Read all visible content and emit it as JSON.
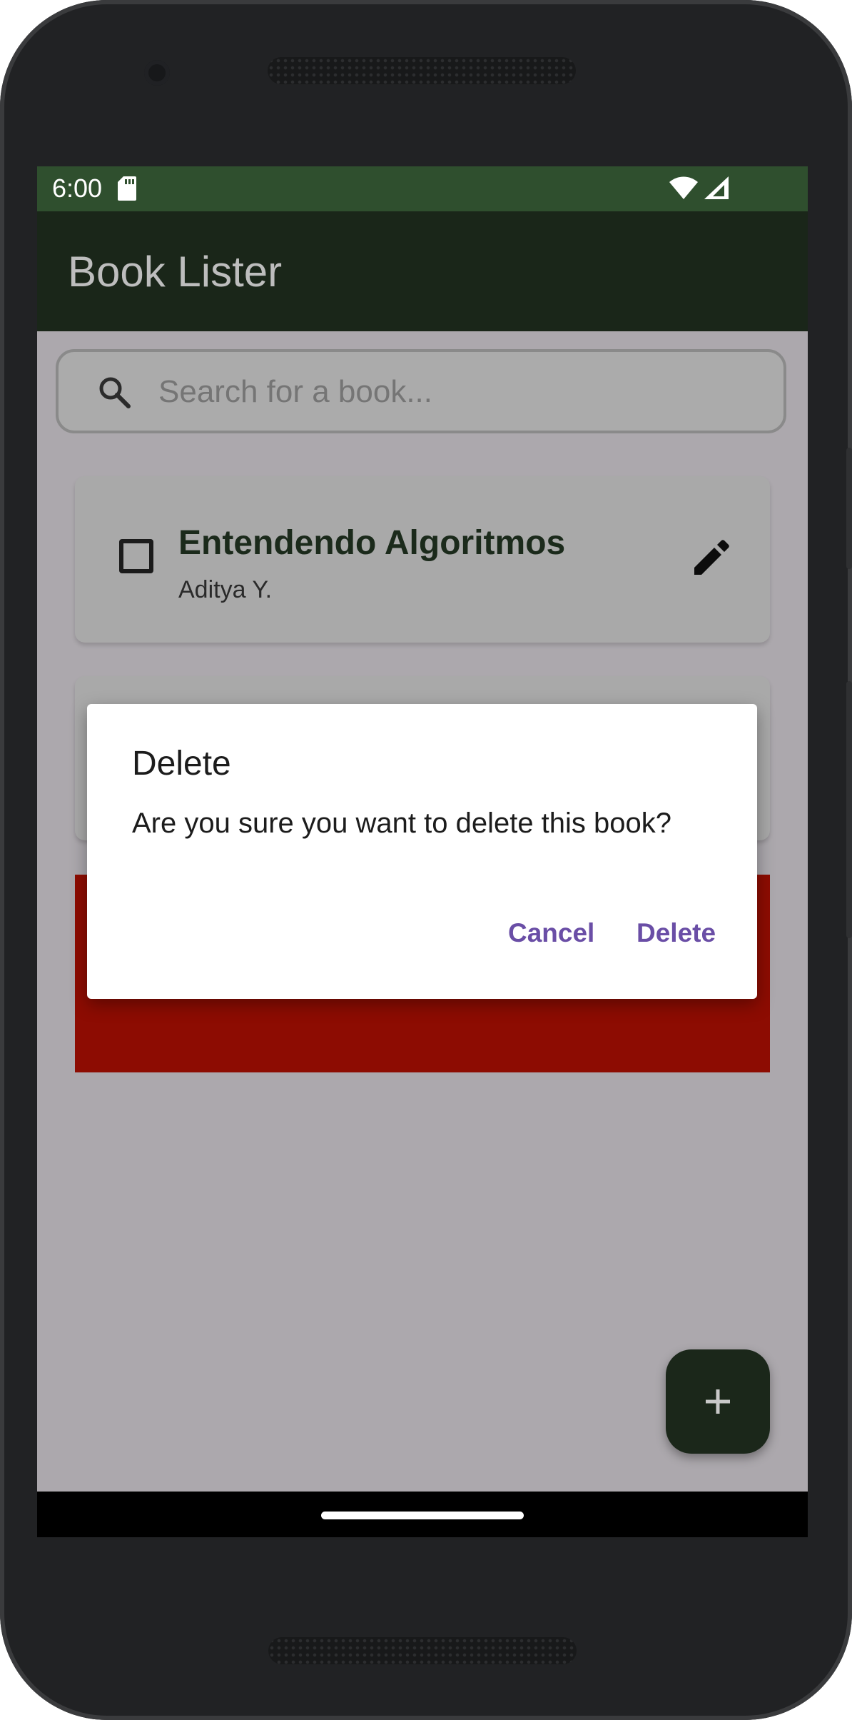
{
  "status_bar": {
    "time": "6:00",
    "icons": [
      "sd-card-icon",
      "wifi-icon",
      "signal-icon"
    ]
  },
  "app_bar": {
    "title": "Book Lister"
  },
  "search": {
    "placeholder": "Search for a book...",
    "value": ""
  },
  "books": [
    {
      "title": "Entendendo Algoritmos",
      "author": "Aditya Y.",
      "checked": false
    }
  ],
  "dialog": {
    "title": "Delete",
    "message": "Are you sure you want to delete this book?",
    "cancel_label": "Cancel",
    "confirm_label": "Delete"
  },
  "fab": {
    "icon": "plus-icon"
  },
  "colors": {
    "status_bar": "#2f4f2e",
    "app_bar": "#1a2619",
    "scrim_background": "#aca8ad",
    "swipe_delete": "#8d0c02",
    "dialog_button": "#6a4ea6",
    "fab": "#1b271a"
  }
}
